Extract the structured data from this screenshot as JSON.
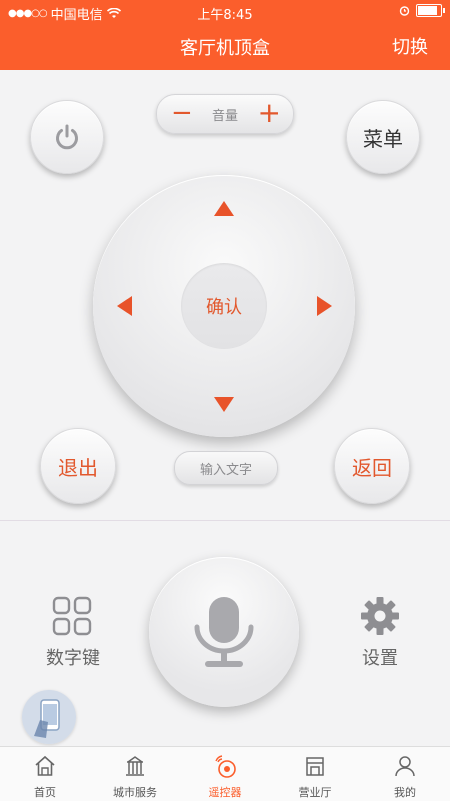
{
  "status_bar": {
    "signal": "●●●○○",
    "carrier": "中国电信",
    "time": "上午8:45",
    "battery_percent": 95
  },
  "header": {
    "title": "客厅机顶盒",
    "switch_label": "切换",
    "background_color": "#fb5e2c"
  },
  "remote": {
    "power_icon": "power-icon",
    "menu_label": "菜单",
    "volume": {
      "minus": "−",
      "label": "音量",
      "plus": "+"
    },
    "ok_label": "确认",
    "exit_label": "退出",
    "back_label": "返回",
    "text_input_label": "输入文字",
    "accent_color": "#e2582d"
  },
  "lower": {
    "numpad_label": "数字键",
    "settings_label": "设置",
    "mic_icon": "microphone-icon"
  },
  "tabbar": {
    "tabs": [
      {
        "label": "首页",
        "icon": "home-icon"
      },
      {
        "label": "城市服务",
        "icon": "building-icon"
      },
      {
        "label": "遥控器",
        "icon": "remote-icon",
        "active": true
      },
      {
        "label": "营业厅",
        "icon": "store-icon"
      },
      {
        "label": "我的",
        "icon": "user-icon"
      }
    ]
  }
}
